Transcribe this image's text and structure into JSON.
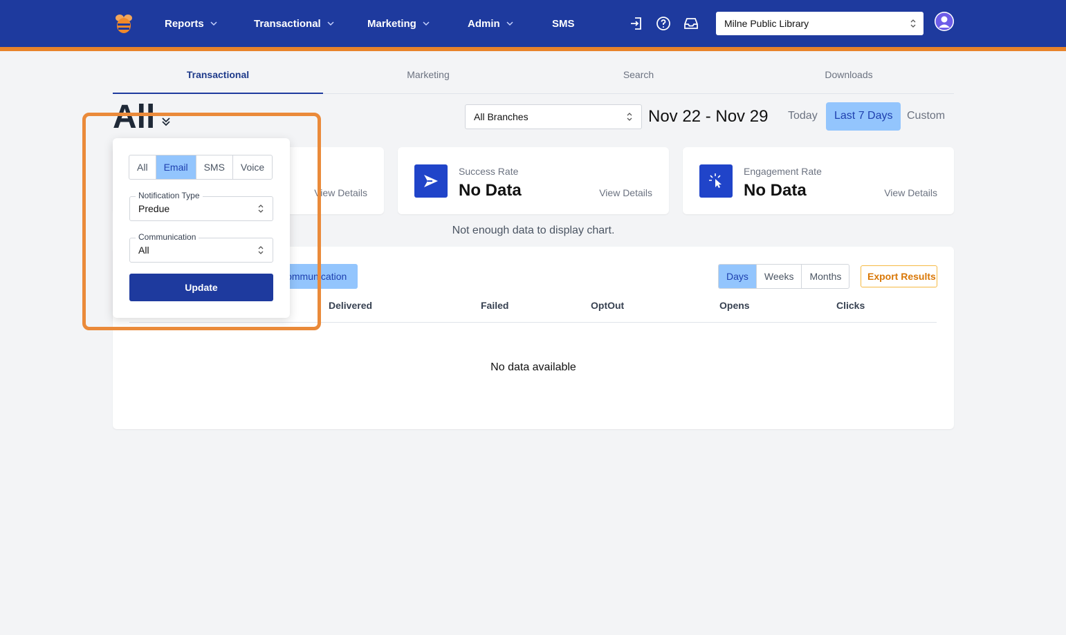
{
  "colors": {
    "nav_bg": "#1e3a9e",
    "nav_accent": "#e8832a",
    "active_blue": "#93c5fd",
    "highlight": "#ea8a3a",
    "export": "#d97706"
  },
  "nav": {
    "logo_icon": "bee-logo-icon",
    "items": [
      {
        "label": "Reports"
      },
      {
        "label": "Transactional"
      },
      {
        "label": "Marketing"
      },
      {
        "label": "Admin"
      },
      {
        "label": "SMS"
      }
    ],
    "icons": [
      "sign-in-icon",
      "help-icon",
      "inbox-icon"
    ],
    "library": "Milne Public Library",
    "avatar_icon": "user-avatar-icon"
  },
  "subtabs": [
    {
      "label": "Transactional",
      "active": true
    },
    {
      "label": "Marketing"
    },
    {
      "label": "Search"
    },
    {
      "label": "Downloads"
    }
  ],
  "header": {
    "title": "All",
    "branch": "All Branches",
    "date_range": "Nov 22 - Nov 29",
    "ranges": [
      "Today",
      "Last 7 Days",
      "Custom"
    ],
    "active_range": "Last 7 Days"
  },
  "cards": [
    {
      "details": "View Details"
    },
    {
      "label": "Success Rate",
      "value": "No Data",
      "details": "View Details",
      "icon": "send-icon"
    },
    {
      "label": "Engagement Rate",
      "value": "No Data",
      "details": "View Details",
      "icon": "click-icon"
    }
  ],
  "chart_message": "Not enough data to display chart.",
  "table": {
    "group_button": "Communication",
    "periods": [
      "Days",
      "Weeks",
      "Months"
    ],
    "active_period": "Days",
    "export": "Export Results",
    "columns": [
      "Delivered",
      "Failed",
      "OptOut",
      "Opens",
      "Clicks"
    ],
    "empty": "No data available"
  },
  "popover": {
    "channels": [
      "All",
      "Email",
      "SMS",
      "Voice"
    ],
    "active_channel": "Email",
    "notification_type": {
      "label": "Notification Type",
      "value": "Predue"
    },
    "communication": {
      "label": "Communication",
      "value": "All"
    },
    "update": "Update"
  }
}
